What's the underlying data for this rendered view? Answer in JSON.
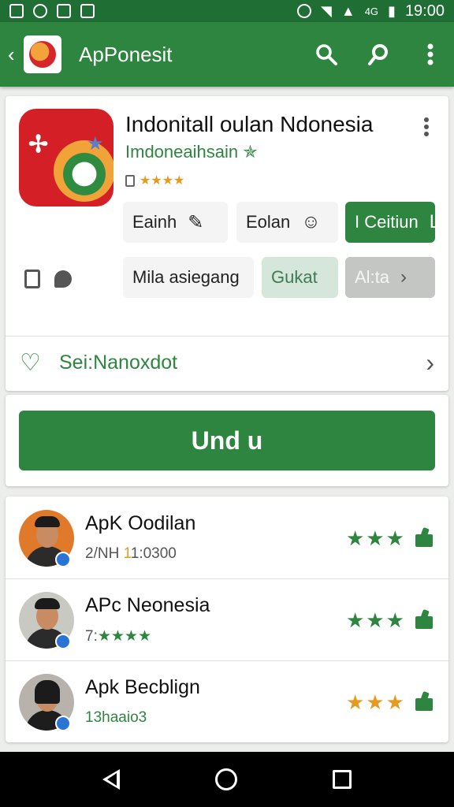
{
  "status_bar": {
    "network_label": "4G",
    "time": "19:00"
  },
  "app_bar": {
    "title": "ApPonesit"
  },
  "app": {
    "name": "Indonitall oulan Ndonesia",
    "developer": "Imdoneaihsain",
    "developer_badge": "✯",
    "rating_stars": "★★★★"
  },
  "chips": [
    {
      "label": "Eainh",
      "icon": "✎"
    },
    {
      "label": "Eolan",
      "icon": "☺"
    },
    {
      "label": "I Ceitiun",
      "icon": "L"
    },
    {
      "label": "Mila asiegang"
    },
    {
      "label": "Gukat"
    },
    {
      "label": "Al:ta",
      "icon": "›"
    }
  ],
  "wishlist": {
    "label": "Sei:Nanoxdot"
  },
  "install": {
    "label": "Und u"
  },
  "reviews": [
    {
      "name": "ApK Oodilan",
      "sub_prefix": "2/NH",
      "sub_highlight": "1",
      "sub_rest": "1:0300",
      "stars": "★★★",
      "star_color": "#2e8540"
    },
    {
      "name": "APc Neonesia",
      "sub_prefix": "7:",
      "sub_highlight": "",
      "sub_rest": "★★★★",
      "stars": "★★★",
      "star_color": "#2e8540"
    },
    {
      "name": "Apk Becblign",
      "sub_prefix": "13",
      "sub_highlight": "",
      "sub_rest": "haaio3",
      "stars": "★★★",
      "star_color": "#e69a1f"
    }
  ],
  "colors": {
    "primary": "#2e8540",
    "status_bar": "#1f6e34",
    "accent_star": "#e69a1f"
  }
}
